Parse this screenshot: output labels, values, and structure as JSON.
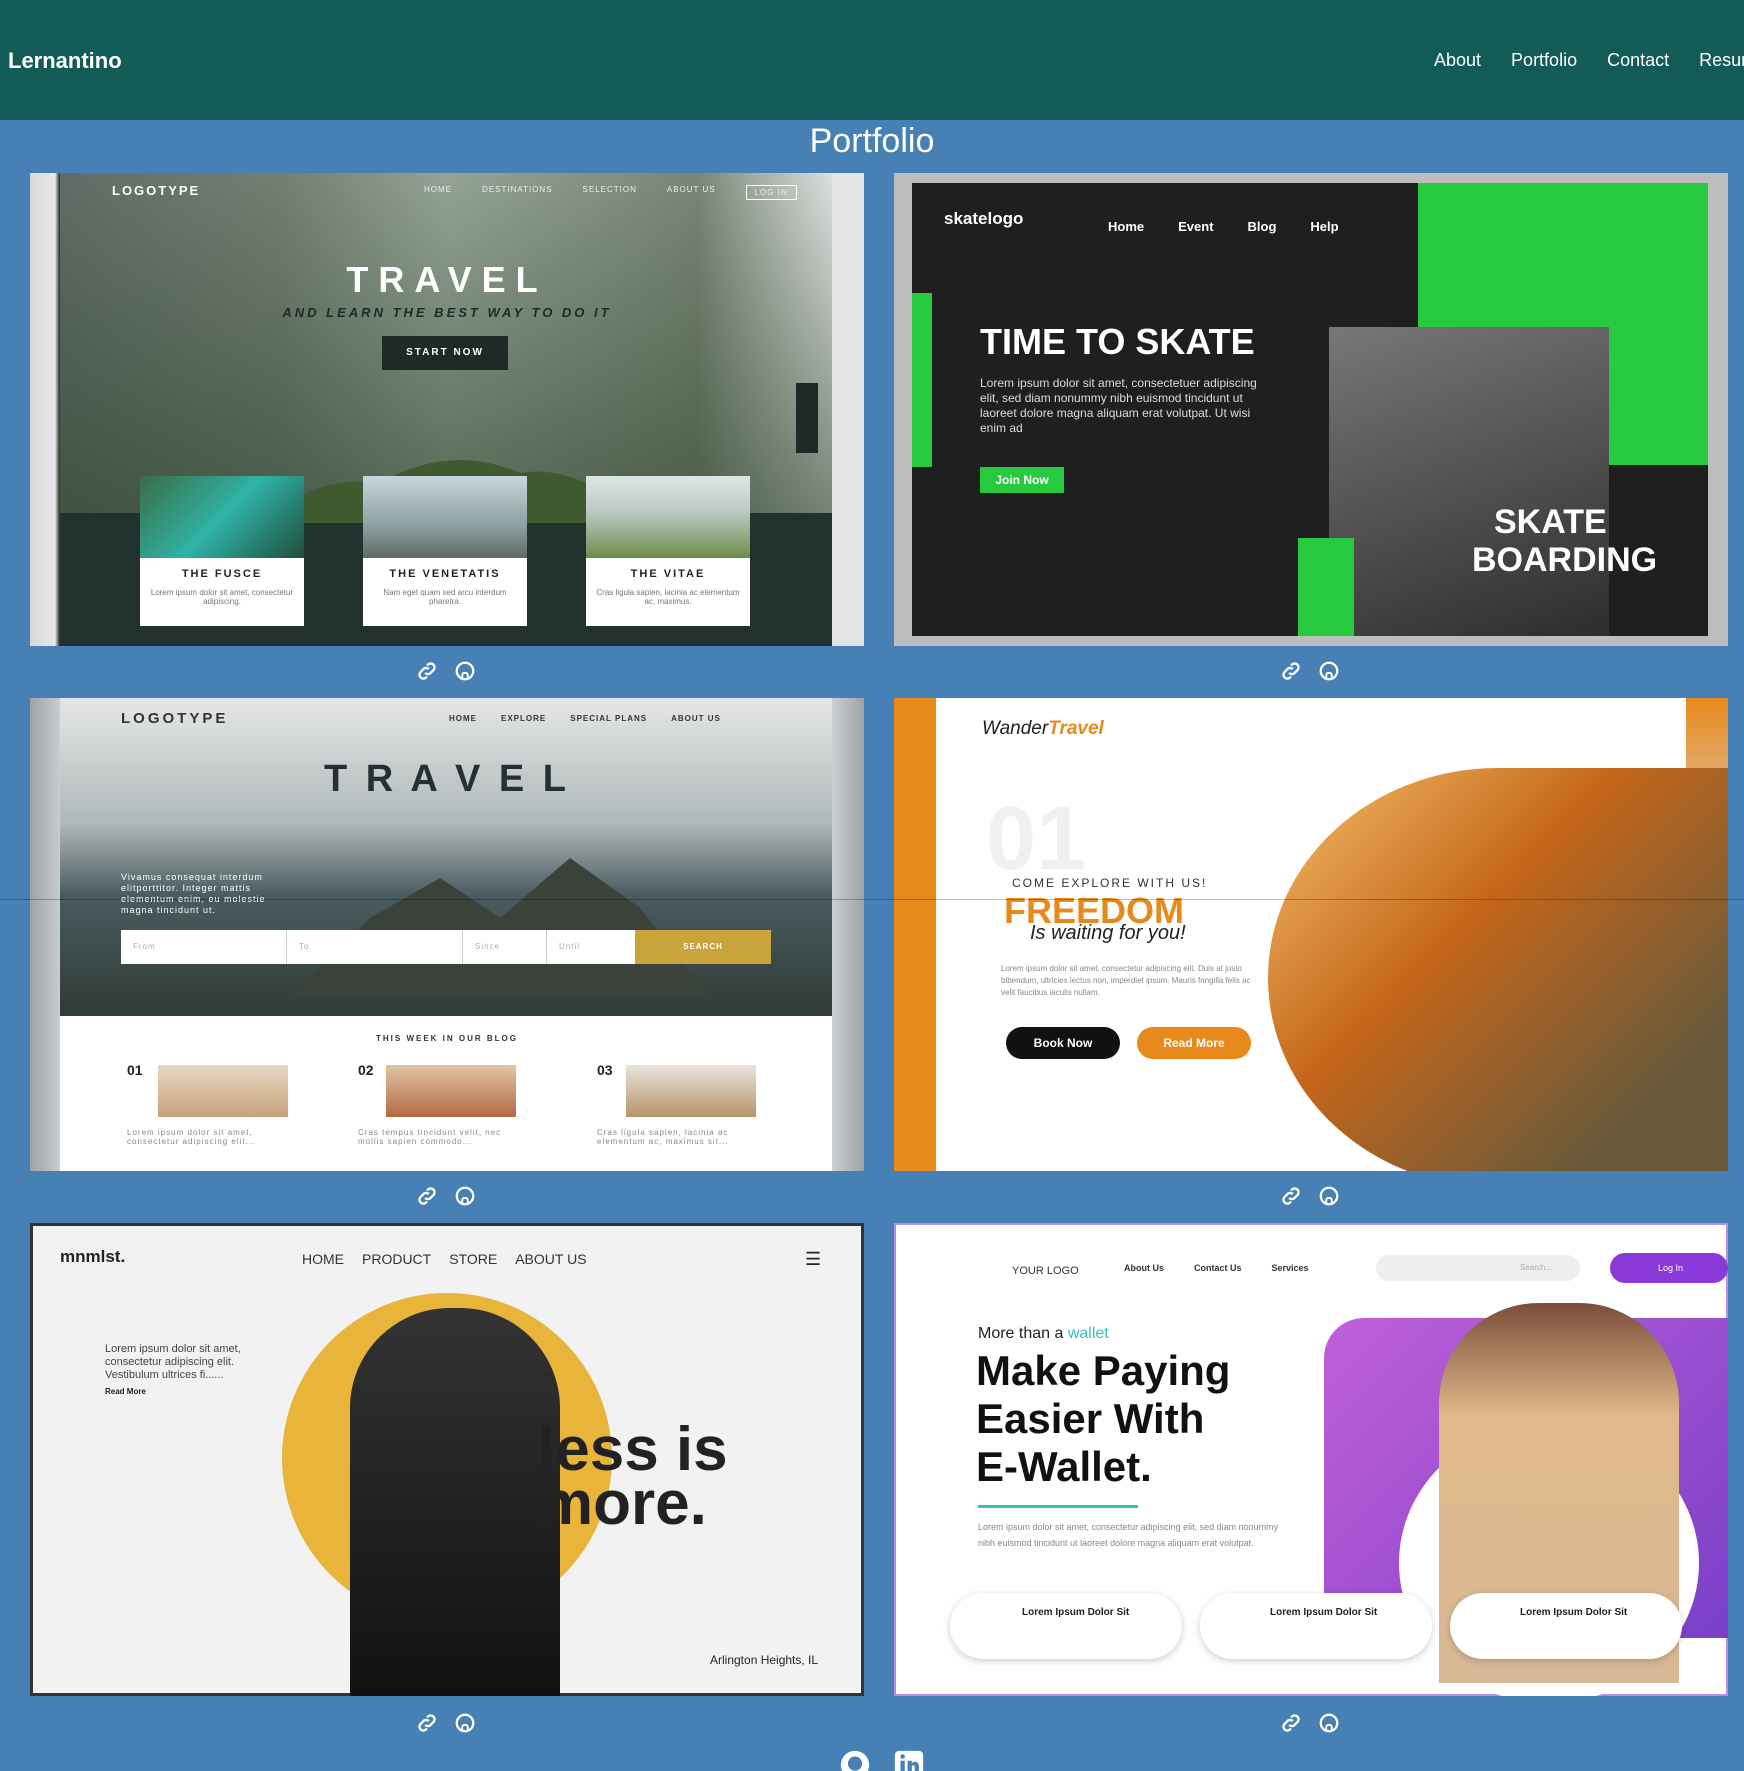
{
  "header": {
    "brand": "Lernantino",
    "nav": [
      "About",
      "Portfolio",
      "Contact",
      "Resume"
    ]
  },
  "section_title": "Portfolio",
  "projects": [
    {
      "name": "travel-1",
      "logo": "LOGOTYPE",
      "nav": [
        "HOME",
        "DESTINATIONS",
        "SELECTION",
        "ABOUT US",
        "LOG IN"
      ],
      "title": "TRAVEL",
      "subtitle": "AND LEARN THE BEST WAY TO DO IT",
      "cta": "START NOW",
      "cards": [
        {
          "title": "THE FUSCE",
          "text": "Lorem ipsum dolor sit amet, consectetur adipiscing."
        },
        {
          "title": "THE VENETATIS",
          "text": "Nam eget quam sed arcu interdum pharetra."
        },
        {
          "title": "THE VITAE",
          "text": "Cras ligula sapien, lacinia ac elementum ac, maximus."
        }
      ]
    },
    {
      "name": "skate",
      "logo": "skatelogo",
      "nav": [
        "Home",
        "Event",
        "Blog",
        "Help"
      ],
      "title": "TIME TO SKATE",
      "text": "Lorem ipsum dolor sit amet, consectetuer adipiscing elit, sed diam nonummy nibh euismod tincidunt ut laoreet dolore magna aliquam erat volutpat. Ut wisi enim ad",
      "cta": "Join Now",
      "side_1": "SKATE",
      "side_2": "BOARDING"
    },
    {
      "name": "travel-2",
      "logo": "LOGOTYPE",
      "nav": [
        "HOME",
        "EXPLORE",
        "SPECIAL PLANS",
        "ABOUT US"
      ],
      "title": "T R A V E L",
      "text": "Vivamus consequat interdum elitporttitor. Integer mattis elementum enim, eu molestie magna tincidunt ut.",
      "fields": [
        "From",
        "To",
        "Since",
        "Until"
      ],
      "search": "SEARCH",
      "blog_title": "THIS WEEK IN OUR BLOG",
      "blog": [
        {
          "num": "01",
          "text": "Lorem ipsum dolor sit amet, consectetur adipiscing elit..."
        },
        {
          "num": "02",
          "text": "Cras tempus tincidunt velit, nec mollis sapien commodo..."
        },
        {
          "num": "03",
          "text": "Cras ligula sapien, lacinia ac elementum ac, maximus sit..."
        }
      ]
    },
    {
      "name": "wander",
      "logo_a": "Wander",
      "logo_b": "Travel",
      "num": "01",
      "kicker": "COME EXPLORE WITH US!",
      "title": "FREEDOM",
      "script": "Is waiting for you!",
      "text": "Lorem ipsum dolor sit amet, consectetur adipiscing elit. Duis at justo bibendum, ultricies lectus non, imperdiet ipsum. Mauris fringilla felis ac velit faucibus iaculis nullam.",
      "cta_1": "Book Now",
      "cta_2": "Read More"
    },
    {
      "name": "mnmlst",
      "logo": "mnmlst.",
      "nav": [
        "HOME",
        "PRODUCT",
        "STORE",
        "ABOUT US"
      ],
      "text": "Lorem ipsum dolor sit amet, consectetur adipiscing elit. Vestibulum ultrices fi......",
      "read_more": "Read More",
      "headline_1": "less is",
      "headline_2": "more.",
      "location": "Arlington Heights, IL"
    },
    {
      "name": "ewallet",
      "logo": "YOUR LOGO",
      "nav": [
        "About Us",
        "Contact Us",
        "Services"
      ],
      "search": "Search...",
      "login": "Log In",
      "kicker_a": "More than a ",
      "kicker_b": "wallet",
      "title_1": "Make Paying",
      "title_2": "Easier With",
      "title_3": "E-Wallet.",
      "text": "Lorem ipsum dolor sit amet, consectetur adipiscing elit, sed diam nonummy nibh euismod tincidunt ut laoreet dolore magna aliquam erat volutpat.",
      "features": [
        "Lorem Ipsum Dolor Sit",
        "Lorem Ipsum Dolor Sit",
        "Lorem Ipsum Dolor Sit"
      ]
    }
  ]
}
